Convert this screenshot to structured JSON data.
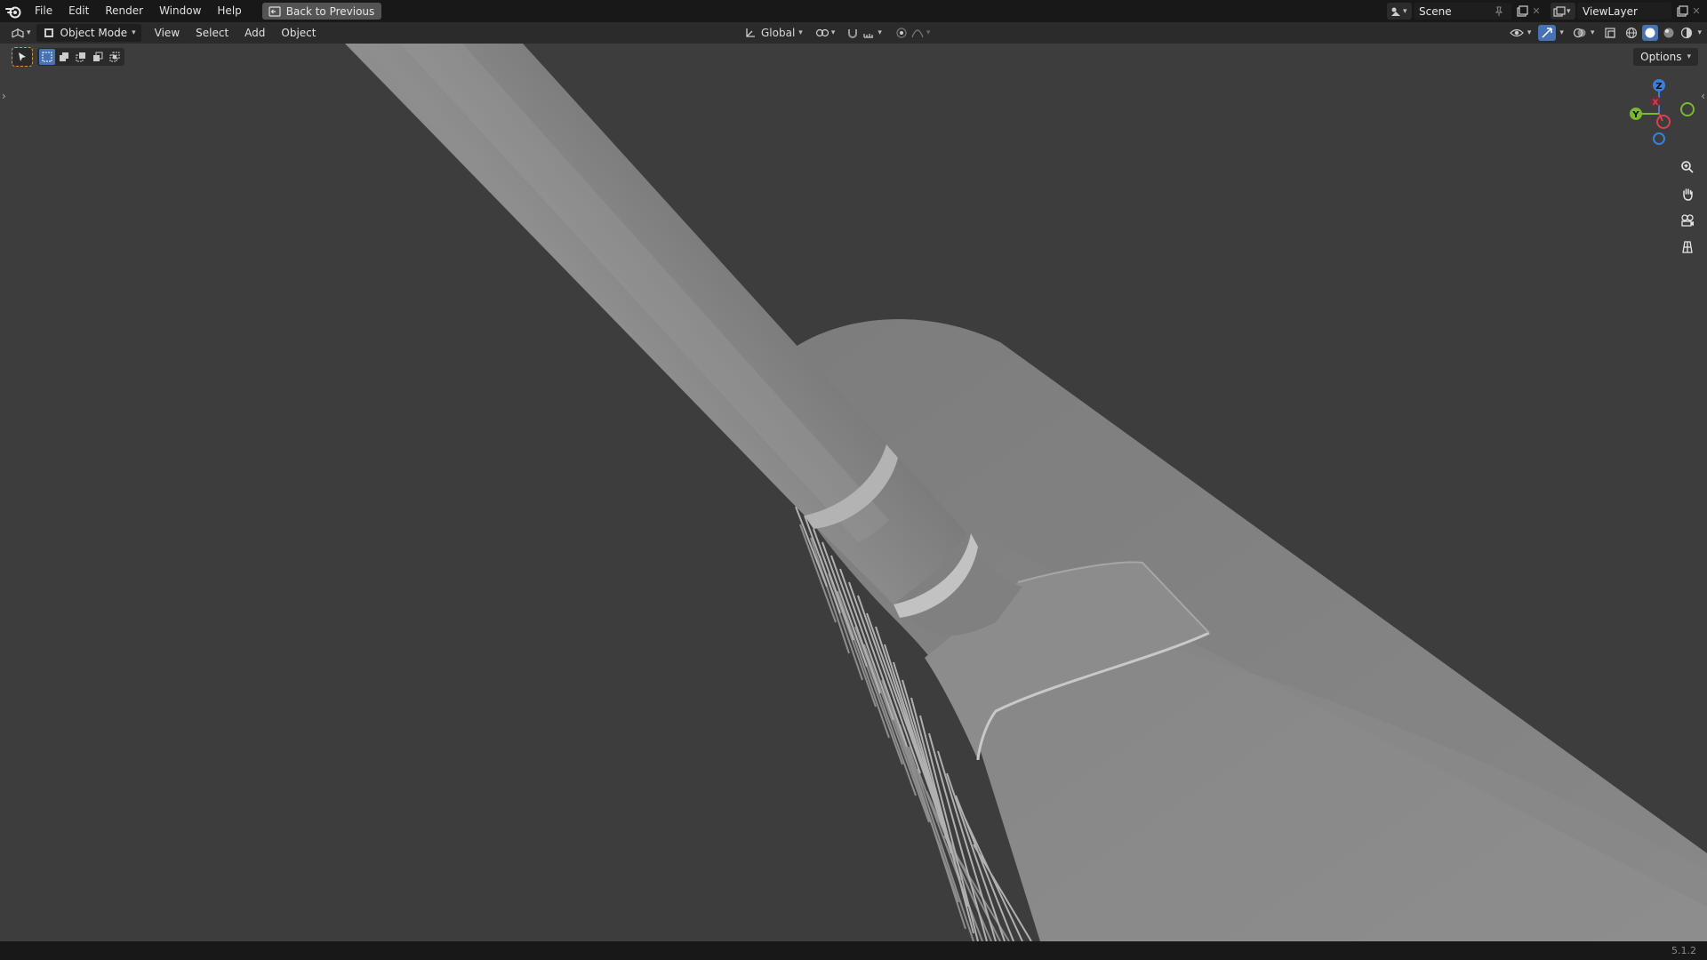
{
  "topbar": {
    "menus": [
      "File",
      "Edit",
      "Render",
      "Window",
      "Help"
    ],
    "back_button": "Back to Previous",
    "scene_name": "Scene",
    "view_layer": "ViewLayer"
  },
  "header": {
    "mode": "Object Mode",
    "menus": [
      "View",
      "Select",
      "Add",
      "Object"
    ],
    "transform_orientation": "Global"
  },
  "viewport": {
    "options_label": "Options",
    "gizmo_axes": {
      "z": "Z",
      "y": "Y",
      "x": "X"
    },
    "colors": {
      "background": "#3d3d3d",
      "x_axis": "#d94152",
      "y_axis": "#7cb82f",
      "z_axis": "#3b7fd8",
      "active": "#4772b3"
    }
  },
  "statusbar": {
    "version": "5.1.2"
  }
}
